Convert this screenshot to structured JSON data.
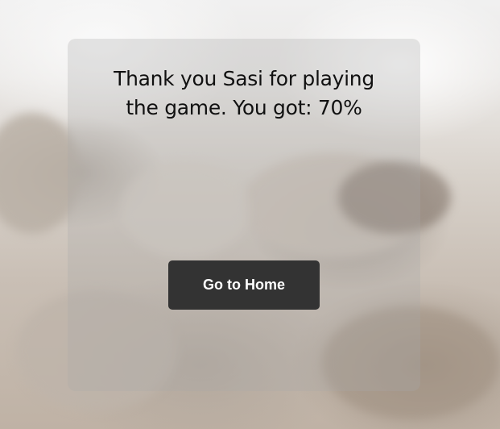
{
  "result": {
    "line1": "Thank you Sasi for playing",
    "line2": "the game. You got: 70%"
  },
  "actions": {
    "home_label": "Go to Home"
  },
  "colors": {
    "button_bg": "#333333",
    "button_text": "#ffffff",
    "text": "#111111"
  }
}
